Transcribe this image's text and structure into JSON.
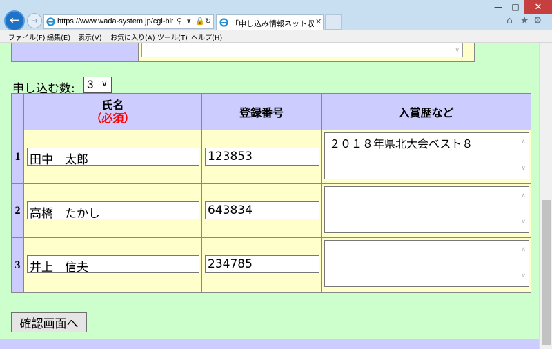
{
  "browser": {
    "url": "https://www.wada-system.jp/cgi-bir",
    "tab_title": "「申し込み情報ネット収集」シ...",
    "menu": [
      "ファイル(F)",
      "編集(E)",
      "表示(V)",
      "お気に入り(A)",
      "ツール(T)",
      "ヘルプ(H)"
    ]
  },
  "form": {
    "count_label": "申し込む数:",
    "count_value": "3",
    "headers": {
      "name": "氏名",
      "required": "（必須）",
      "reg_no": "登録番号",
      "awards": "入賞歴など"
    },
    "rows": [
      {
        "num": "1",
        "name": "田中　太郎",
        "reg_no": "123853",
        "awards": "２０１８年県北大会ベスト８"
      },
      {
        "num": "2",
        "name": "高橋　たかし",
        "reg_no": "643834",
        "awards": ""
      },
      {
        "num": "3",
        "name": "井上　信夫",
        "reg_no": "234785",
        "awards": ""
      }
    ],
    "confirm_button": "確認画面へ"
  },
  "colors": {
    "page_bg": "#ccffcc",
    "header_bg": "#ccccff",
    "cell_bg": "#ffffcc",
    "required_text": "#ff0000"
  },
  "icons": [
    "back-arrow-icon",
    "forward-arrow-icon",
    "ie-logo-icon",
    "search-icon",
    "lock-icon",
    "refresh-icon",
    "home-icon",
    "favorites-star-icon",
    "settings-gear-icon"
  ]
}
